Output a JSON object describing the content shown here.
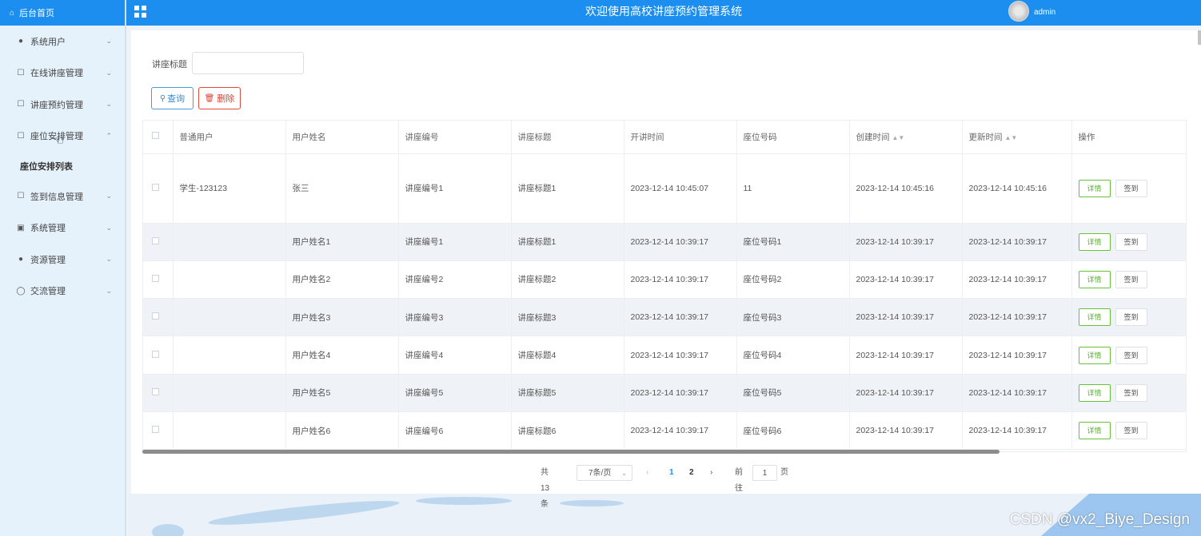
{
  "header": {
    "title": "欢迎使用高校讲座预约管理系统",
    "username": "admin"
  },
  "sidebar": {
    "home": "后台首页",
    "items": [
      {
        "label": "系统用户",
        "icon": "user-icon",
        "expanded": false
      },
      {
        "label": "在线讲座管理",
        "icon": "document-icon",
        "expanded": false
      },
      {
        "label": "讲座预约管理",
        "icon": "document-icon",
        "expanded": false
      },
      {
        "label": "座位安排管理",
        "icon": "document-icon",
        "expanded": true
      },
      {
        "label": "签到信息管理",
        "icon": "document-icon",
        "expanded": false
      },
      {
        "label": "系统管理",
        "icon": "image-icon",
        "expanded": false
      },
      {
        "label": "资源管理",
        "icon": "location-icon",
        "expanded": false
      },
      {
        "label": "交流管理",
        "icon": "chat-icon",
        "expanded": false
      }
    ],
    "active_sub": "座位安排列表"
  },
  "search": {
    "label": "讲座标题",
    "value": "",
    "placeholder": ""
  },
  "buttons": {
    "query": "查询",
    "delete": "删除"
  },
  "table": {
    "columns": [
      "普通用户",
      "用户姓名",
      "讲座编号",
      "讲座标题",
      "开讲时间",
      "座位号码",
      "创建时间",
      "更新时间",
      "操作"
    ],
    "detail_label": "详情",
    "sign_label": "签到",
    "rows": [
      [
        "学生-123123",
        "张三",
        "讲座编号1",
        "讲座标题1",
        "2023-12-14 10:45:07",
        "11",
        "2023-12-14 10:45:16",
        "2023-12-14 10:45:16"
      ],
      [
        "",
        "用户姓名1",
        "讲座编号1",
        "讲座标题1",
        "2023-12-14 10:39:17",
        "座位号码1",
        "2023-12-14 10:39:17",
        "2023-12-14 10:39:17"
      ],
      [
        "",
        "用户姓名2",
        "讲座编号2",
        "讲座标题2",
        "2023-12-14 10:39:17",
        "座位号码2",
        "2023-12-14 10:39:17",
        "2023-12-14 10:39:17"
      ],
      [
        "",
        "用户姓名3",
        "讲座编号3",
        "讲座标题3",
        "2023-12-14 10:39:17",
        "座位号码3",
        "2023-12-14 10:39:17",
        "2023-12-14 10:39:17"
      ],
      [
        "",
        "用户姓名4",
        "讲座编号4",
        "讲座标题4",
        "2023-12-14 10:39:17",
        "座位号码4",
        "2023-12-14 10:39:17",
        "2023-12-14 10:39:17"
      ],
      [
        "",
        "用户姓名5",
        "讲座编号5",
        "讲座标题5",
        "2023-12-14 10:39:17",
        "座位号码5",
        "2023-12-14 10:39:17",
        "2023-12-14 10:39:17"
      ],
      [
        "",
        "用户姓名6",
        "讲座编号6",
        "讲座标题6",
        "2023-12-14 10:39:17",
        "座位号码6",
        "2023-12-14 10:39:17",
        "2023-12-14 10:39:17"
      ]
    ]
  },
  "pagination": {
    "total": "共 13 条",
    "page_size": "7条/页",
    "pages": [
      "1",
      "2"
    ],
    "current": "1",
    "goto_label": "前往",
    "goto_value": "1",
    "page_suffix": "页"
  },
  "watermark": "CSDN @vx2_Biye_Design",
  "colors": {
    "primary": "#1b8ef0",
    "sidebar_bg": "#e5f1fb",
    "success": "#67c23a",
    "danger": "#e04b3a"
  }
}
